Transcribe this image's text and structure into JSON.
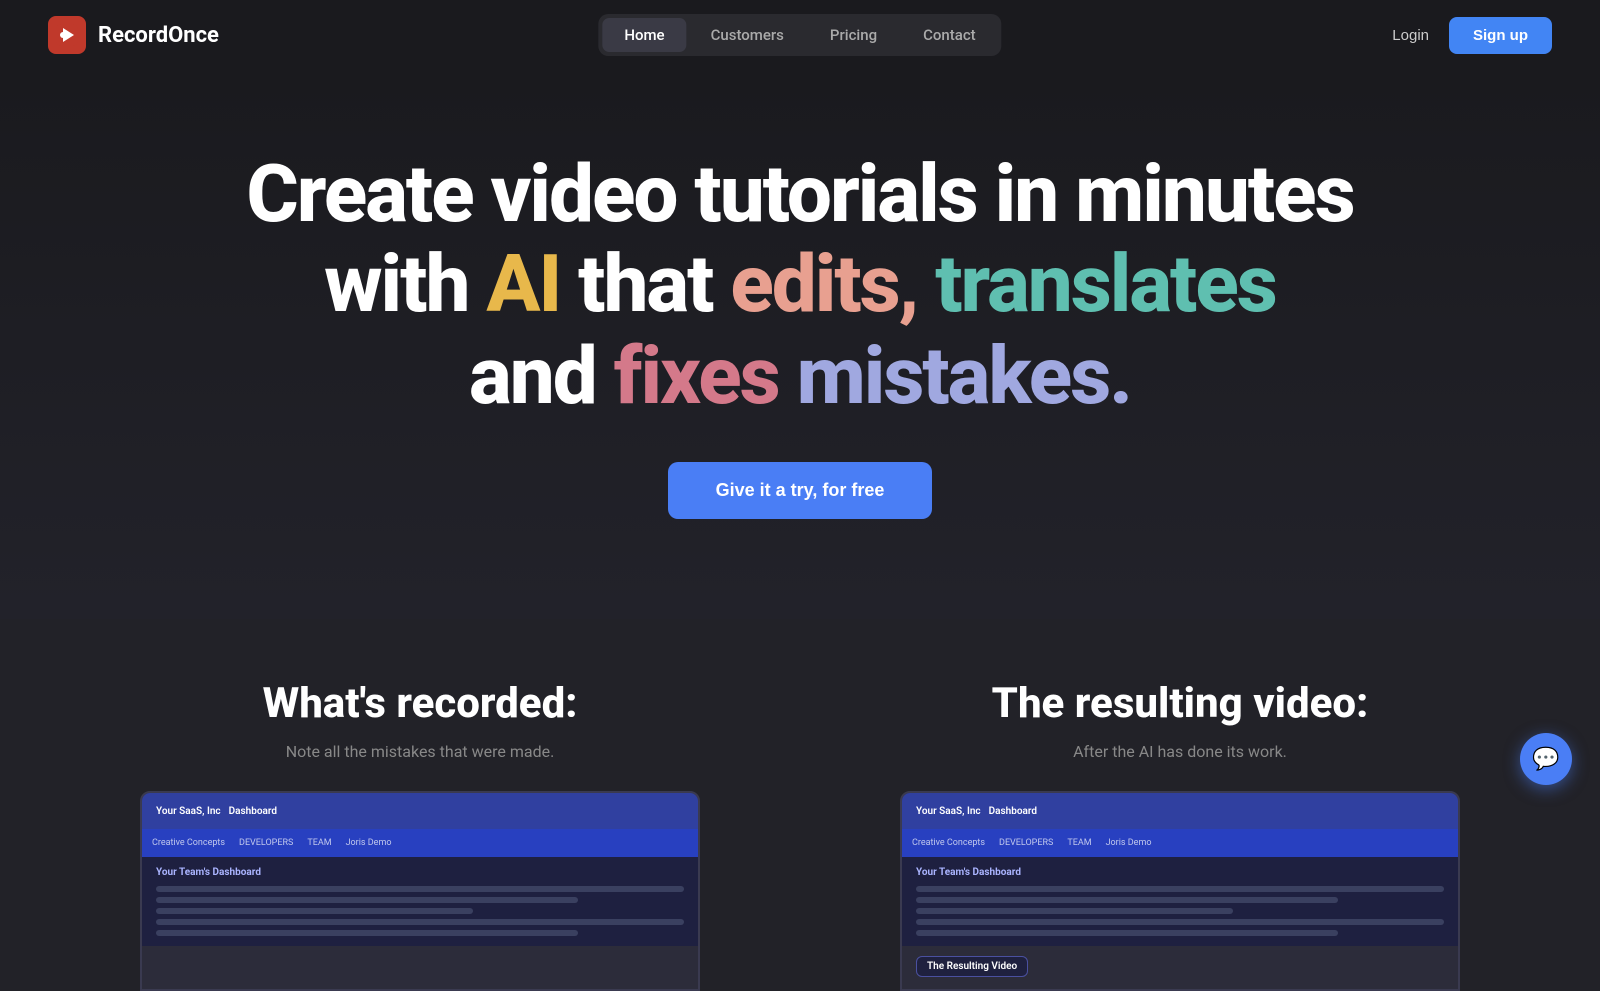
{
  "brand": {
    "name": "RecordOnce",
    "logo_symbol": "🖱"
  },
  "navbar": {
    "items": [
      {
        "label": "Home",
        "active": true
      },
      {
        "label": "Customers",
        "active": false
      },
      {
        "label": "Pricing",
        "active": false
      },
      {
        "label": "Contact",
        "active": false
      }
    ],
    "login_label": "Login",
    "signup_label": "Sign up"
  },
  "hero": {
    "line1": "Create video tutorials in minutes",
    "line2_parts": [
      {
        "text": "with ",
        "color": "white"
      },
      {
        "text": "AI",
        "color": "yellow"
      },
      {
        "text": " that ",
        "color": "white"
      },
      {
        "text": "edits,",
        "color": "salmon"
      }
    ],
    "line2_part2": [
      {
        "text": "translates",
        "color": "teal"
      }
    ],
    "line3_parts": [
      {
        "text": "and ",
        "color": "white"
      },
      {
        "text": "fixes",
        "color": "pink"
      },
      {
        "text": " mistakes.",
        "color": "lavender"
      }
    ],
    "cta_label": "Give it a try, for free"
  },
  "bottom": {
    "left": {
      "title": "What's recorded:",
      "subtitle": "Note all the mistakes that were made.",
      "screenshot_title": "Your SaaS, Inc",
      "tab_label": "Dashboard"
    },
    "right": {
      "title": "The resulting video:",
      "subtitle": "After the AI has done its work.",
      "screenshot_label": "The Resulting Video",
      "screenshot_title": "Your SaaS, Inc"
    }
  }
}
